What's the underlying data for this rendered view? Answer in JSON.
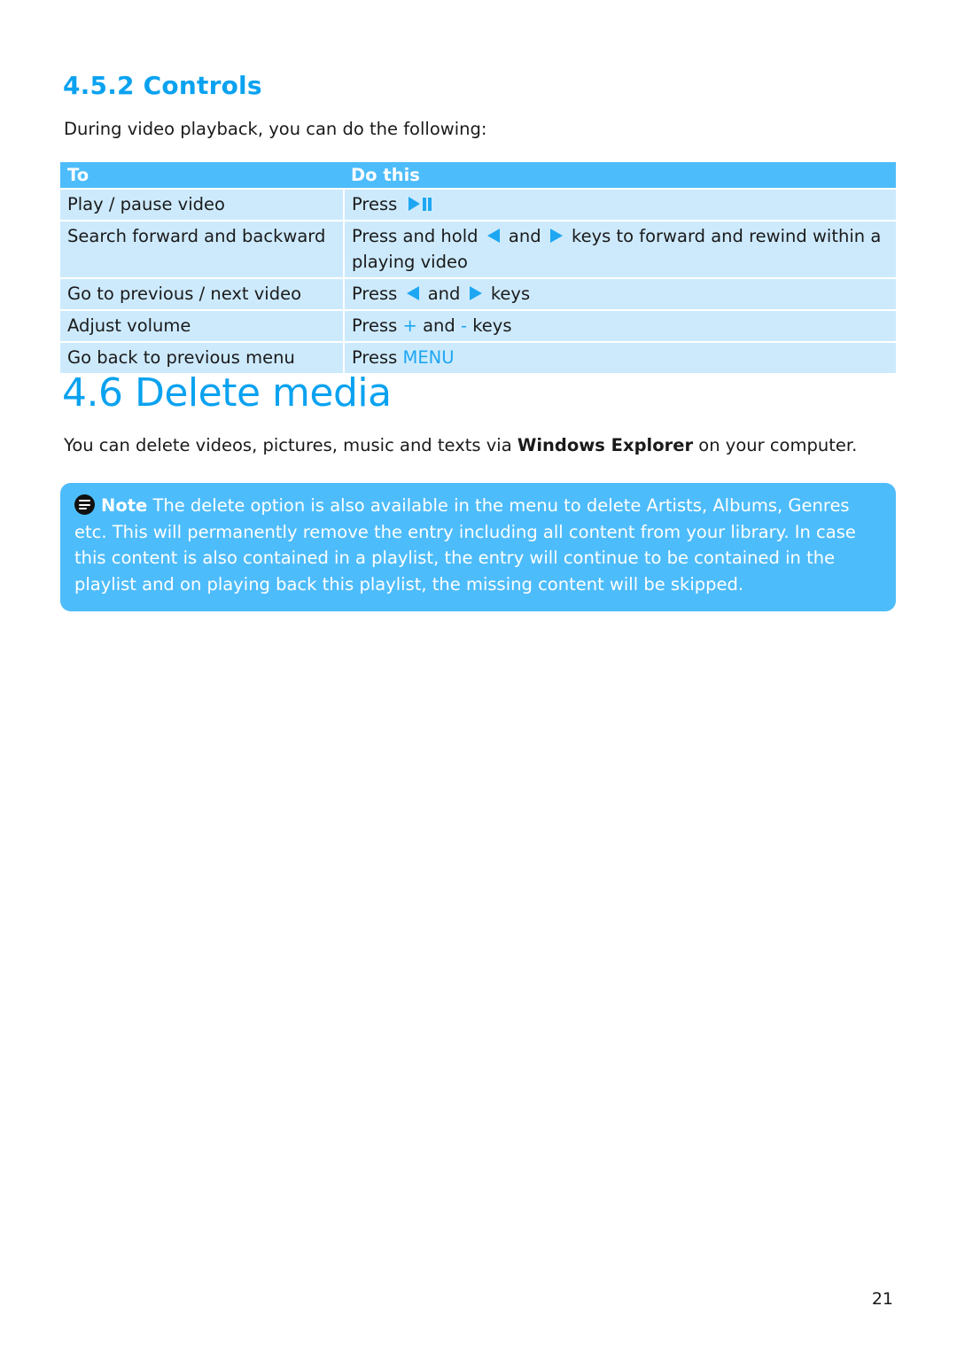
{
  "controls_section": {
    "heading": "4.5.2 Controls",
    "intro": "During video playback, you can do the following:",
    "table": {
      "headers": [
        "To",
        "Do this"
      ],
      "rows": [
        {
          "to": "Play / pause video",
          "do": [
            {
              "t": "Press "
            },
            {
              "icon": "play-pause-icon"
            }
          ]
        },
        {
          "to": "Search forward and backward",
          "do": [
            {
              "t": "Press and hold "
            },
            {
              "icon": "left-arrow-icon"
            },
            {
              "t": " and "
            },
            {
              "icon": "right-arrow-icon"
            },
            {
              "t": " keys to forward and rewind within a playing video"
            }
          ]
        },
        {
          "to": "Go to previous / next video",
          "do": [
            {
              "t": "Press "
            },
            {
              "icon": "left-arrow-icon"
            },
            {
              "t": " and "
            },
            {
              "icon": "right-arrow-icon"
            },
            {
              "t": " keys"
            }
          ]
        },
        {
          "to": "Adjust volume",
          "do": [
            {
              "t": "Press "
            },
            {
              "accent": "+"
            },
            {
              "t": " and "
            },
            {
              "accent": "-"
            },
            {
              "t": " keys"
            }
          ]
        },
        {
          "to": "Go back to previous menu",
          "do": [
            {
              "t": "Press "
            },
            {
              "accent": "MENU"
            }
          ]
        }
      ]
    }
  },
  "delete_section": {
    "heading": "4.6  Delete media",
    "body_before": "You can delete videos, pictures, music and texts via ",
    "body_bold": "Windows Explorer",
    "body_after": " on your computer.",
    "note": {
      "icon": "note-icon",
      "label": "Note",
      "text": " The delete option is also available in the menu to delete Artists, Albums, Genres etc. This will permanently remove the entry including all content from your library. In case this content is also contained in a playlist, the entry will continue to be contained in the playlist and on playing back this playlist, the missing content will be skipped."
    }
  },
  "page_number": "21",
  "colors": {
    "accent": "#0aa2f0",
    "header_bg": "#4dbcfb",
    "row_bg": "#cdeafd"
  }
}
